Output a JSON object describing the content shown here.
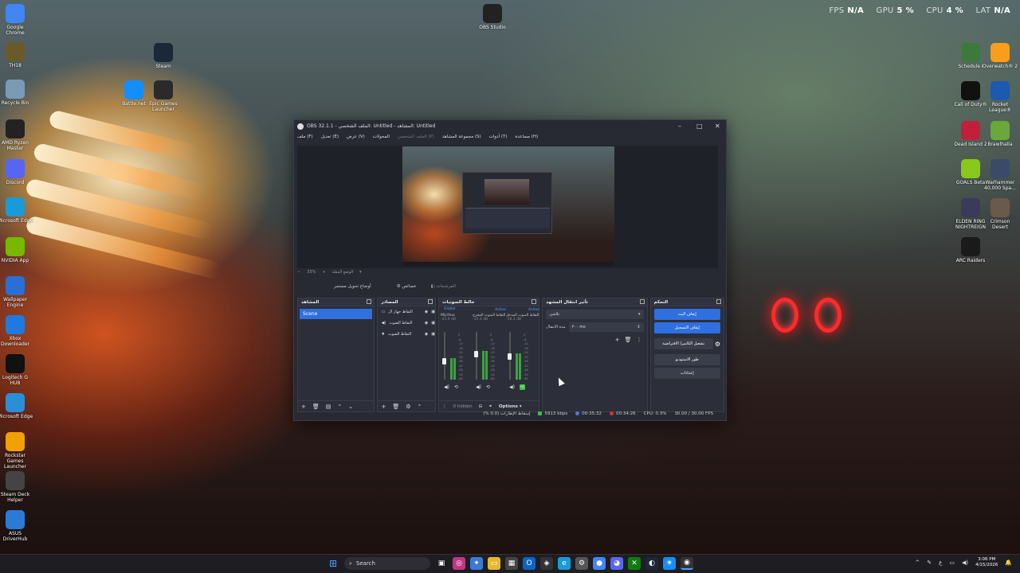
{
  "overlay": {
    "fps_label": "FPS",
    "fps_value": "N/A",
    "gpu_label": "GPU",
    "gpu_value": "5 %",
    "cpu_label": "CPU",
    "cpu_value": "4 %",
    "lat_label": "LAT",
    "lat_value": "N/A"
  },
  "desktop_icons_left": [
    {
      "label": "Google Chrome",
      "icon": "chrome-icon",
      "color": "#4285f4"
    },
    {
      "label": "TH18",
      "icon": "app-icon",
      "color": "#6a5a2a"
    },
    {
      "label": "Recycle Bin",
      "icon": "recycle-bin-icon",
      "color": "#7a9bb5"
    },
    {
      "label": "AMD Ryzen Master",
      "icon": "ryzen-icon",
      "color": "#222222"
    },
    {
      "label": "Discord",
      "icon": "discord-icon",
      "color": "#5865f2"
    },
    {
      "label": "Microsoft Edge",
      "icon": "edge-icon",
      "color": "#1a9ad6"
    },
    {
      "label": "NVIDIA App",
      "icon": "nvidia-icon",
      "color": "#76b900"
    },
    {
      "label": "Wallpaper Engine",
      "icon": "wallpaper-engine-icon",
      "color": "#2a6fd6"
    },
    {
      "label": "Xbox Downloader",
      "icon": "downloader-icon",
      "color": "#1f7ae0"
    },
    {
      "label": "Logitech G HUB",
      "icon": "logitech-icon",
      "color": "#111111"
    },
    {
      "label": "Microsoft Edge",
      "icon": "edge-icon",
      "color": "#2a8fd6"
    },
    {
      "label": "Rockstar Games Launcher",
      "icon": "rockstar-icon",
      "color": "#f0a000"
    },
    {
      "label": "Steam Deck Helper",
      "icon": "helper-icon",
      "color": "#444444"
    },
    {
      "label": "ASUS DriverHub",
      "icon": "asus-icon",
      "color": "#2a7ad6"
    }
  ],
  "desktop_icons_mid": [
    {
      "label": "Steam",
      "icon": "steam-icon",
      "color": "#1b2838"
    },
    {
      "label": "Battle.net",
      "icon": "battlenet-icon",
      "color": "#148eff"
    },
    {
      "label": "Epic Games Launcher",
      "icon": "epic-games-icon",
      "color": "#2a2a2a"
    },
    {
      "label": "OBS Studio",
      "icon": "obs-icon",
      "color": "#222222"
    }
  ],
  "desktop_icons_right": [
    {
      "label": "Schedule I",
      "icon": "schedule-icon",
      "color": "#3a7a3a"
    },
    {
      "label": "Overwatch® 2",
      "icon": "overwatch-icon",
      "color": "#f99e1a"
    },
    {
      "label": "Call of Duty®",
      "icon": "cod-icon",
      "color": "#111111"
    },
    {
      "label": "Rocket League®",
      "icon": "rocket-league-icon",
      "color": "#1a5ab0"
    },
    {
      "label": "Dead Island 2",
      "icon": "dead-island-icon",
      "color": "#c0203a"
    },
    {
      "label": "Brawlhalla",
      "icon": "brawlhalla-icon",
      "color": "#6aa83a"
    },
    {
      "label": "GOALS Beta",
      "icon": "goals-icon",
      "color": "#8ac81a"
    },
    {
      "label": "Warhammer 40,000 Spa...",
      "icon": "warhammer-icon",
      "color": "#3a4a6a"
    },
    {
      "label": "ELDEN RING NIGHTREIGN",
      "icon": "elden-ring-icon",
      "color": "#3a3a5a"
    },
    {
      "label": "Crimson Desert",
      "icon": "crimson-desert-icon",
      "color": "#6a5a4a"
    },
    {
      "label": "ARC Raiders",
      "icon": "arc-raiders-icon",
      "color": "#1a1a1a"
    }
  ],
  "obs": {
    "title": "OBS 32.1.1 - الملف الشخصي: Untitled - المشاهد: Untitled",
    "menu": [
      "ملف (F)",
      "تعديل (E)",
      "عرض (V)",
      "المحولات",
      "الملف الشخصي (P)",
      "مجموعة المشاهد (S)",
      "أدوات (T)",
      "مساعدة (H)"
    ],
    "zoom_label": "33%",
    "mode_label": "الوضع المقلد",
    "studio_mode_label": "أوضاع تحويل مستمر",
    "btn_settings_small": "خصائص",
    "btn_filters_small": "المرشحات",
    "docks": {
      "scenes_title": "المشاهد",
      "scene_item": "Scene",
      "sources_title": "المصادر",
      "sources": [
        "التقاط جهاز ال",
        "التقاط الصوت",
        "التقاط الصوت"
      ],
      "mixer_title": "خالط الصوتيات",
      "mixer_global": "Global",
      "mixer_channels": [
        {
          "name": "Mic/Aux",
          "active": "",
          "db": "-25.9 dB",
          "level": 0.45
        },
        {
          "name": "التقاط الصوت المخرج",
          "active": "Active",
          "db": "-15.3 dB",
          "level": 0.6
        },
        {
          "name": "التقاط الصوت المدخل",
          "active": "Active",
          "db": "-18.3 dB",
          "level": 0.55
        }
      ],
      "mixer_ticks": [
        "0",
        "-6",
        "-12",
        "-18",
        "-24",
        "-30",
        "-36",
        "-42",
        "-48",
        "-54",
        "-60"
      ],
      "hidden_label": "0 hidden",
      "options_label": "Options",
      "transitions_title": "تأثير انتقال المشهد",
      "transition_value": "تلاشي",
      "duration_label": "مدة الانتقال",
      "duration_value": "٣٠٠ ms",
      "controls_title": "التحكم",
      "controls": [
        "إيقاف البث",
        "إيقاف التسجيل",
        "تشغيل الكاميرا الافتراضية",
        "طور الاستوديو",
        "إعدادات"
      ]
    },
    "status": {
      "dropped": "إسقاط الإطارات (0.0 %)",
      "bitrate": "5913 kbps",
      "stream_time": "00:35:32",
      "rec_time": "00:34:26",
      "cpu": "CPU: 0.3%",
      "fps": "30.00 / 30.00 FPS"
    }
  },
  "taskbar": {
    "search_placeholder": "Search",
    "lang": "ع",
    "time": "3:06 PM",
    "date": "4/15/2026"
  },
  "colors": {
    "obs_bg": "#272a33",
    "accent_blue": "#2f6fe0",
    "taillight_red": "#ff2a2a"
  }
}
